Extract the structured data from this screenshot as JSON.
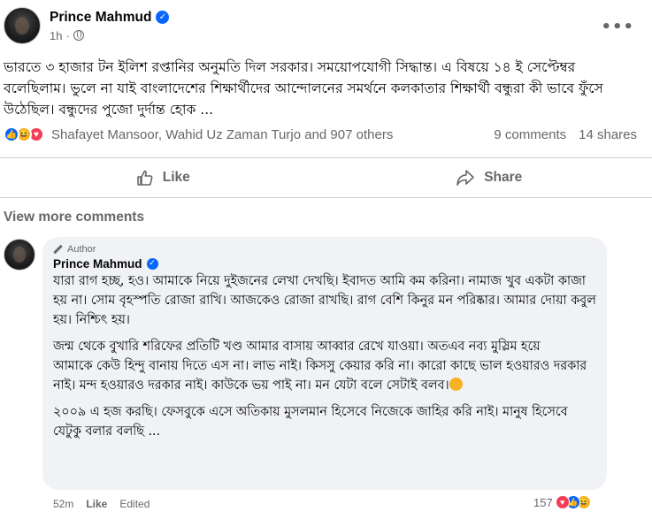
{
  "post": {
    "author": "Prince Mahmud",
    "time": "1h",
    "body": "ভারতে ৩ হাজার টন ইলিশ রপ্তানির অনুমতি দিল সরকার। সময়োপযোগী সিদ্ধান্ত। এ বিষয়ে ১৪ ই সেপ্টেম্বর বলেছিলাম। ভুলে না যাই বাংলাদেশের শিক্ষার্থীদের আন্দোলনের সমর্থনে কলকাতার শিক্ষার্থী বন্ধুরা কী ভাবে ফুঁসে উঠেছিল। বন্ধুদের পুজো দুর্দান্ত হোক ..."
  },
  "engagement": {
    "reactors": "Shafayet Mansoor, Wahid Uz Zaman Turjo and 907 others",
    "comments": "9 comments",
    "shares": "14 shares"
  },
  "actions": {
    "like": "Like",
    "share": "Share"
  },
  "view_more": "View more comments",
  "comment": {
    "badge": "Author",
    "author": "Prince Mahmud",
    "para1": "যারা রাগ হচ্ছ, হও। আমাকে নিয়ে দুইজনের লেখা দেখছি। ইবাদত আমি কম করিনা। নামাজ খুব একটা কাজা হয় না। সোম বৃহস্পতি রোজা রাখি। আজকেও রোজা রাখছি। রাগ বেশি কিনুর মন পরিষ্কার। আমার দোয়া কবুল হয়। নিশ্চিৎ হয়।",
    "para2_line1": "জন্ম থেকে বুখারি শরিফের প্রতিটি খণ্ড আমার বাসায় আব্বার রেখে যাওয়া। অতএব নব্য মুস্লিম হয়ে",
    "para2_line2": "আমাকে কেউ হিন্দু বানায় দিতে এস না। লাভ নাই। কিসসু কেয়ার করি না। কারো কাছে ভাল হওয়ারও দরকার নাই। মন্দ হওয়ারও দরকার নাই। কাউকে ভয় পাই না। মন যেটা বলে সেটাই বলব।",
    "para3": "২০০৯ এ হজ করছি। ফেসবুকে এসে অতিকায় মুসলমান হিসেবে নিজেকে জাহির করি নাই। মানুষ হিসেবে যেটুকু বলার বলছি ...",
    "time": "52m",
    "like": "Like",
    "edited": "Edited",
    "reaction_count": "157"
  },
  "icons": {
    "verified": "verified-badge-icon",
    "globe": "globe-icon",
    "more": "more-options-icon",
    "like": "thumbs-up-icon",
    "share": "share-arrow-icon",
    "author_pen": "pen-icon"
  },
  "colors": {
    "accent": "#0866ff",
    "secondary_text": "#65676b",
    "bubble": "#f0f2f5",
    "love": "#f33e58",
    "haha": "#f7b125"
  }
}
